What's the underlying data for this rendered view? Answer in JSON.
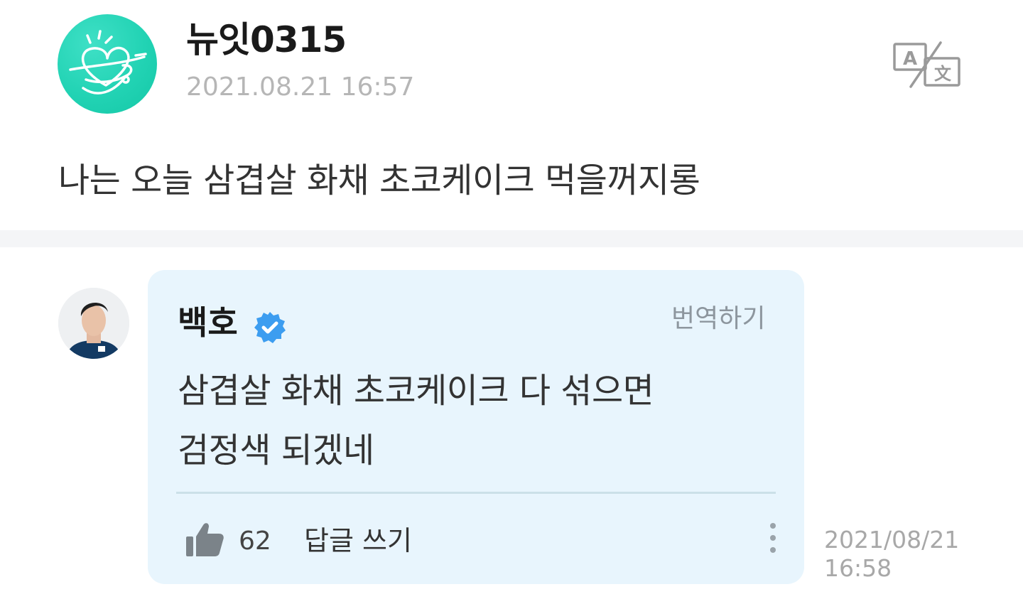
{
  "post": {
    "author_name": "뉴잇0315",
    "timestamp": "2021.08.21 16:57",
    "body": "나는 오늘 삼겹살 화채 초코케이크 먹을꺼지롱",
    "avatar_icon": "heart-doodle-avatar",
    "translate_icon": "translate-icon"
  },
  "comment": {
    "author_name": "백호",
    "verified_icon": "verified-badge-icon",
    "translate_label": "번역하기",
    "text_lines": [
      "삼겹살 화채 초코케이크 다 섞으면",
      "검정색 되겠네"
    ],
    "like_count": "62",
    "reply_label": "답글 쓰기",
    "timestamp_date": "2021/08/21",
    "timestamp_time": "16:58"
  },
  "colors": {
    "avatar_teal": "#22d3b4",
    "comment_bg": "#e8f5fd",
    "verified_blue": "#3c9df0",
    "divider_band": "#f4f5f7"
  }
}
